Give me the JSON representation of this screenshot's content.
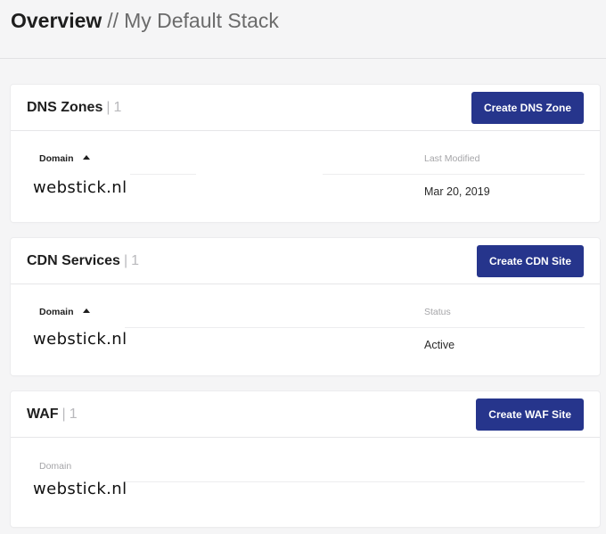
{
  "header": {
    "title": "Overview",
    "separator": "//",
    "stack_name": "My Default Stack"
  },
  "sections": [
    {
      "title": "DNS Zones",
      "count": "1",
      "button_label": "Create DNS Zone",
      "columns": [
        "Domain",
        "Last Modified"
      ],
      "rows": [
        {
          "domain": "webstick.nl",
          "value": "Mar 20, 2019"
        }
      ]
    },
    {
      "title": "CDN Services",
      "count": "1",
      "button_label": "Create CDN Site",
      "columns": [
        "Domain",
        "Status"
      ],
      "rows": [
        {
          "domain": "webstick.nl",
          "value": "Active"
        }
      ]
    },
    {
      "title": "WAF",
      "count": "1",
      "button_label": "Create WAF Site",
      "columns": [
        "Domain"
      ],
      "rows": [
        {
          "domain": "webstick.nl"
        }
      ]
    }
  ],
  "colors": {
    "button": "#26358c",
    "background": "#f5f5f6",
    "muted_text": "#a5a5a8"
  },
  "icons": [
    "sort-ascending-icon"
  ]
}
